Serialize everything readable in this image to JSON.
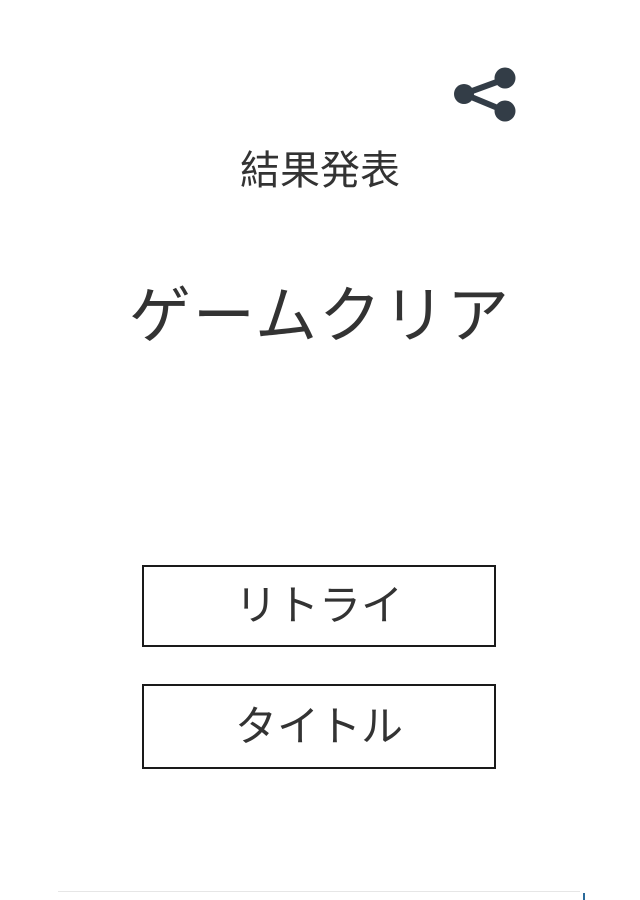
{
  "share": {
    "icon": "share-icon",
    "color": "#333d47"
  },
  "heading": "結果発表",
  "result": "ゲームクリア",
  "buttons": {
    "retry_label": "リトライ",
    "title_label": "タイトル"
  },
  "colors": {
    "text": "#333333",
    "border": "#1a1a1a",
    "background": "#ffffff"
  }
}
